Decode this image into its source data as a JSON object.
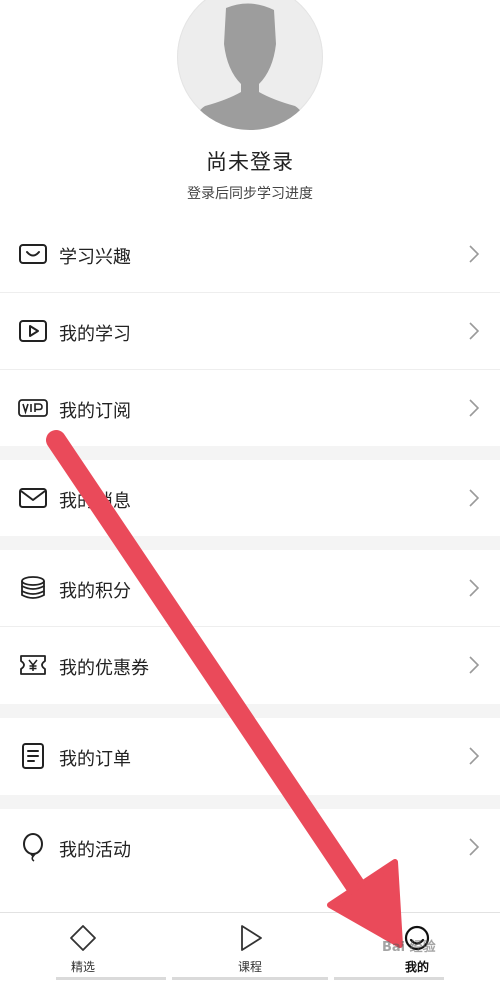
{
  "profile": {
    "title": "尚未登录",
    "subtitle": "登录后同步学习进度"
  },
  "menu": {
    "interests": "学习兴趣",
    "learning": "我的学习",
    "subscriptions": "我的订阅",
    "messages": "我的消息",
    "points": "我的积分",
    "coupons": "我的优惠券",
    "orders": "我的订单",
    "activities": "我的活动"
  },
  "tabs": {
    "featured": "精选",
    "courses": "课程",
    "mine": "我的"
  },
  "colors": {
    "annotation_arrow": "#ea4a5a",
    "gap": "#f4f4f4"
  },
  "annotation": {
    "watermark": "Bai 经验"
  }
}
